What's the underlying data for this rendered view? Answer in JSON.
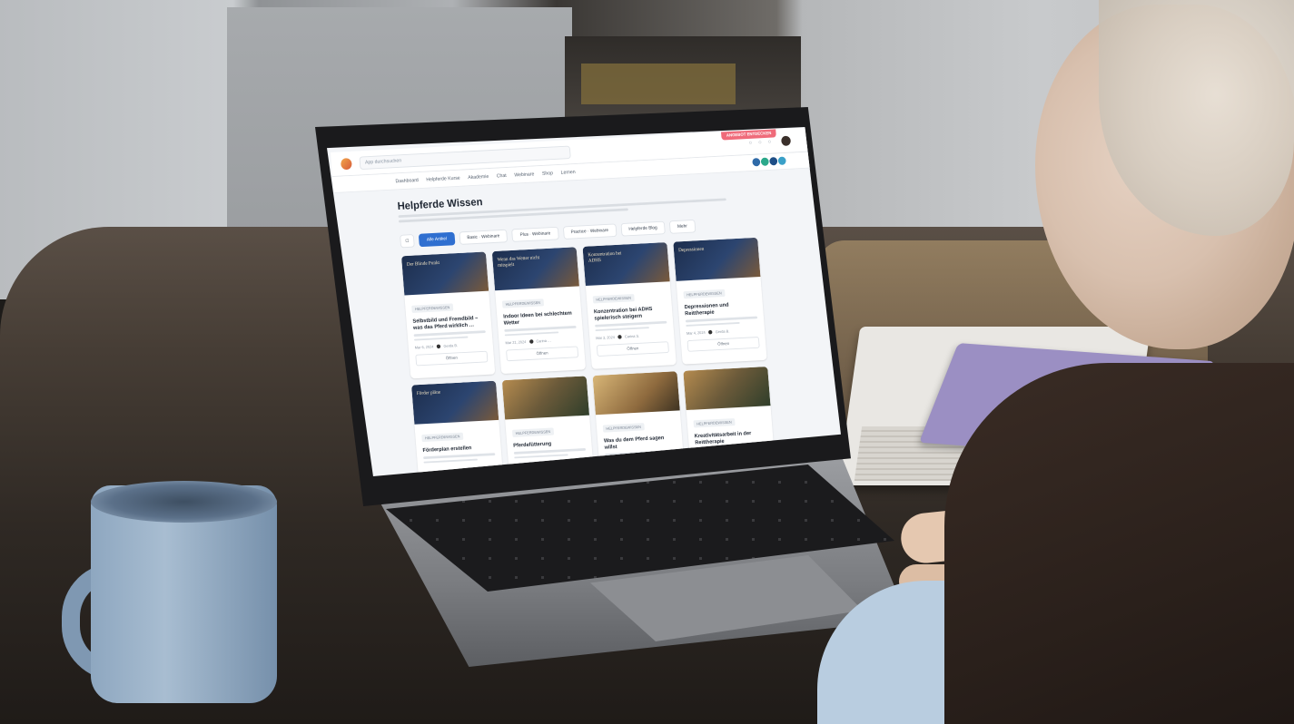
{
  "site": {
    "search_placeholder": "App durchsuchen",
    "promo_label": "ANGEBOT ENTDECKEN",
    "nav": [
      "Dashboard",
      "Helpferde Kurse",
      "Akademie",
      "Chat",
      "Webinare",
      "Shop",
      "Lernen"
    ],
    "page_title": "Helpferde Wissen",
    "filters": [
      "Alle Artikel",
      "Basic · Webinare",
      "Plus · Webinare",
      "Practice · Webinare",
      "Helpferde Blog",
      "Mehr"
    ],
    "cards": [
      {
        "thumb_text": "Der Blinde Punkt",
        "tag": "HELPFERDEWISSEN",
        "title": "Selbstbild und Fremdbild – was das Pferd wirklich …",
        "date": "Mar 6, 2024",
        "author": "Gerda B.",
        "button": "Öffnen"
      },
      {
        "thumb_text": "Wenn das Wetter nicht mitspielt",
        "tag": "HELPFERDEWISSEN",
        "title": "Indoor Ideen bei schlechtem Wetter",
        "date": "Mar 21, 2024",
        "author": "Carina …",
        "button": "Öffnen"
      },
      {
        "thumb_text": "Konzentration bei ADHS",
        "tag": "HELPFERDEWISSEN",
        "title": "Konzentration bei ADHS spielerisch steigern",
        "date": "Mar 3, 2024",
        "author": "Carina S.",
        "button": "Öffnen"
      },
      {
        "thumb_text": "Depressionen",
        "tag": "HELPFERDEWISSEN",
        "title": "Depressionen und Reittherapie",
        "date": "Mar 4, 2024",
        "author": "Gerda B.",
        "button": "Öffnen"
      },
      {
        "thumb_text": "Förder pläne",
        "tag": "HELPFERDEWISSEN",
        "title": "Förderplan erstellen",
        "date": "",
        "author": "",
        "button": ""
      },
      {
        "thumb_text": "",
        "tag": "HELPFERDEWISSEN",
        "title": "Pferdefütterung",
        "date": "",
        "author": "",
        "button": ""
      },
      {
        "thumb_text": "",
        "tag": "HELPFERDEWISSEN",
        "title": "Was du dem Pferd sagen willst",
        "date": "",
        "author": "",
        "button": ""
      },
      {
        "thumb_text": "",
        "tag": "HELPFERDEWISSEN",
        "title": "Kreativitätsarbeit in der Reittherapie",
        "date": "",
        "author": "",
        "button": ""
      }
    ]
  },
  "colors": {
    "accent": "#2f6fd0",
    "promo": "#ef6b7a",
    "page_bg": "#f3f5f8"
  }
}
